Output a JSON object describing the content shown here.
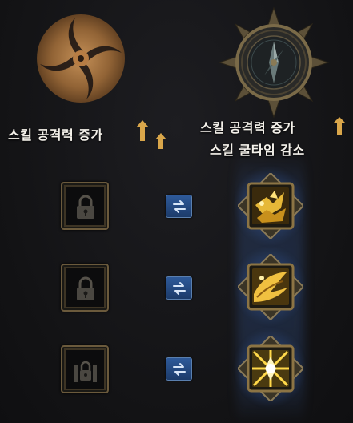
{
  "ranks": {
    "left": {
      "emblem_icon": "swirl-emblem-icon",
      "text": "스킬 공격력 증가",
      "arrows": 2,
      "color": "#b07a40"
    },
    "right": {
      "emblem_icon": "compass-emblem-icon",
      "line1": "스킬 공격력 증가",
      "line2": "스킬 쿨타임 감소",
      "arrows": 1,
      "color": "#8a7a55"
    }
  },
  "rows": [
    {
      "locked_icon": "padlock-icon",
      "swap_icon": "swap-arrows-icon",
      "skill_icon": "golden-birds-skill-icon"
    },
    {
      "locked_icon": "padlock-icon",
      "swap_icon": "swap-arrows-icon",
      "skill_icon": "golden-wing-skill-icon"
    },
    {
      "locked_icon": "gate-lock-icon",
      "swap_icon": "swap-arrows-icon",
      "skill_icon": "radiant-burst-skill-icon"
    }
  ],
  "colors": {
    "gold": "#d9a64a",
    "swap_blue": "#2e5a9a",
    "glow_blue": "#5a96e6"
  }
}
